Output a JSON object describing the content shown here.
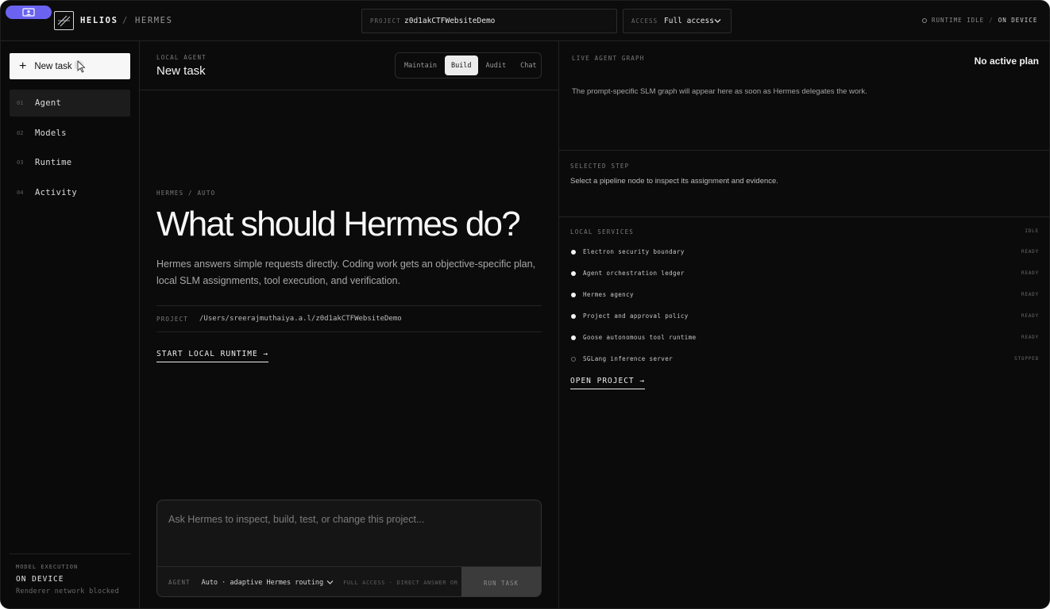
{
  "topbar": {
    "brand": "HELIOS",
    "separator": "/",
    "section": "HERMES",
    "project_label": "PROJECT",
    "project_value": "z0d1akCTFWebsiteDemo",
    "access_label": "ACCESS",
    "access_value": "Full access",
    "runtime_status": "RUNTIME IDLE",
    "status_sep": "/",
    "device_status": "ON DEVICE",
    "accent_color": "#6b63f0"
  },
  "sidebar": {
    "new_task": "New task",
    "items": [
      {
        "num": "01",
        "label": "Agent",
        "active": true
      },
      {
        "num": "02",
        "label": "Models"
      },
      {
        "num": "03",
        "label": "Runtime"
      },
      {
        "num": "04",
        "label": "Activity"
      }
    ],
    "footer": {
      "label": "MODEL EXECUTION",
      "value": "ON DEVICE",
      "note": "Renderer network blocked"
    }
  },
  "center": {
    "eyebrow": "LOCAL AGENT",
    "title": "New task",
    "tabs": [
      "Maintain",
      "Build",
      "Audit",
      "Chat"
    ],
    "active_tab": "Build",
    "crumb": "HERMES / AUTO",
    "headline": "What should Hermes do?",
    "description": "Hermes answers simple requests directly. Coding work gets an objective-specific plan, local SLM assignments, tool execution, and verification.",
    "project_label": "PROJECT",
    "project_path": "/Users/sreerajmuthaiya.a.l/z0d1akCTFWebsiteDemo",
    "start_link": "START LOCAL RUNTIME →",
    "composer": {
      "placeholder": "Ask Hermes to inspect, build, test, or change this project...",
      "agent_label": "AGENT",
      "agent_value": "Auto · adaptive Hermes routing",
      "meta": "FULL ACCESS · DIRECT ANSWER OR PL...",
      "run_button": "RUN TASK"
    }
  },
  "right": {
    "graph_label": "LIVE AGENT GRAPH",
    "no_plan": "No active plan",
    "graph_text": "The prompt-specific SLM graph will appear here as soon as Hermes delegates the work.",
    "step_label": "SELECTED STEP",
    "step_text": "Select a pipeline node to inspect its assignment and evidence.",
    "services_label": "LOCAL SERVICES",
    "services_status": "IDLE",
    "services": [
      {
        "name": "Electron security boundary",
        "status": "READY"
      },
      {
        "name": "Agent orchestration ledger",
        "status": "READY"
      },
      {
        "name": "Hermes agency",
        "status": "READY"
      },
      {
        "name": "Project and approval policy",
        "status": "READY"
      },
      {
        "name": "Goose autonomous tool runtime",
        "status": "READY"
      },
      {
        "name": "SGLang inference server",
        "status": "STOPPED"
      }
    ],
    "open_project": "OPEN PROJECT →"
  }
}
